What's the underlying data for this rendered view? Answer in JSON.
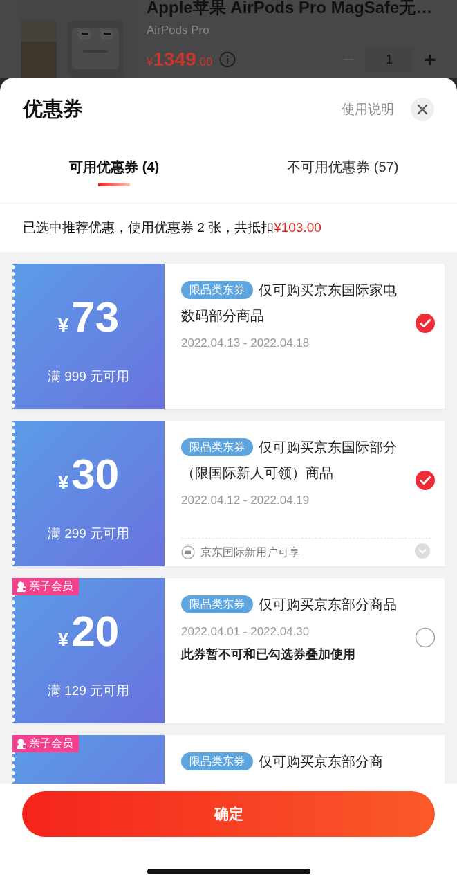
{
  "product": {
    "title": "Apple苹果 AirPods Pro MagSafe无…",
    "subtitle": "AirPods Pro",
    "currency": "¥",
    "price_int": "1349",
    "price_dec": ".00",
    "quantity": "1",
    "minus": "−",
    "plus": "+"
  },
  "sheet": {
    "title": "优惠券",
    "help_link": "使用说明"
  },
  "tabs": [
    {
      "label": "可用优惠券 (4)",
      "selected": true
    },
    {
      "label": "不可用优惠券 (57)",
      "selected": false
    }
  ],
  "summary": {
    "text": "已选中推荐优惠，使用优惠券 2 张，共抵扣",
    "amount": "¥103.00"
  },
  "coupons": [
    {
      "currency": "¥",
      "amount": "73",
      "threshold": "满 999 元可用",
      "tag": "限品类东券",
      "description": "仅可购买京东国际家电数码部分商品",
      "dates": "2022.04.13 - 2022.04.18",
      "selected": true
    },
    {
      "currency": "¥",
      "amount": "30",
      "threshold": "满 299 元可用",
      "tag": "限品类东券",
      "description": "仅可购买京东国际部分（限国际新人可领）商品",
      "dates": "2022.04.12 - 2022.04.19",
      "selected": true,
      "footer": "京东国际新用户可享"
    },
    {
      "member_tag": "亲子会员",
      "currency": "¥",
      "amount": "20",
      "threshold": "满 129 元可用",
      "tag": "限品类东券",
      "description": "仅可购买京东部分商品",
      "dates": "2022.04.01 - 2022.04.30",
      "note": "此券暂不可和已勾选券叠加使用",
      "selected": false
    },
    {
      "member_tag": "亲子会员",
      "tag": "限品类东券",
      "description": "仅可购买京东部分商"
    }
  ],
  "confirm_button": "确定"
}
